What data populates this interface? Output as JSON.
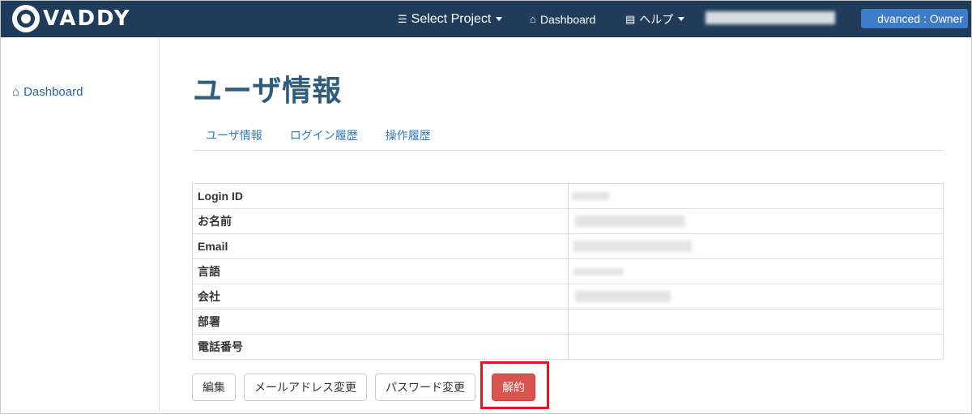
{
  "brand": {
    "name": "VADDY"
  },
  "navbar": {
    "project_label": "Select Project",
    "dashboard_label": "Dashboard",
    "help_label": "ヘルプ",
    "user_badge": "dvanced : Owner"
  },
  "sidebar": {
    "items": [
      {
        "label": "Dashboard",
        "icon": "home-icon"
      }
    ]
  },
  "page": {
    "title": "ユーザ情報",
    "tabs": [
      {
        "label": "ユーザ情報"
      },
      {
        "label": "ログイン履歴"
      },
      {
        "label": "操作履歴"
      }
    ]
  },
  "user_info": {
    "rows": [
      {
        "label": "Login ID"
      },
      {
        "label": "お名前"
      },
      {
        "label": "Email"
      },
      {
        "label": "言語"
      },
      {
        "label": "会社"
      },
      {
        "label": "部署"
      },
      {
        "label": "電話番号"
      }
    ]
  },
  "actions": {
    "edit_label": "編集",
    "change_email_label": "メールアドレス変更",
    "change_password_label": "パスワード変更",
    "cancel_contract_label": "解約"
  },
  "colors": {
    "navbar_bg": "#1f3c5a",
    "title": "#2f5c7b",
    "link": "#337ab7",
    "danger": "#d9534f",
    "highlight": "#e8141c"
  }
}
